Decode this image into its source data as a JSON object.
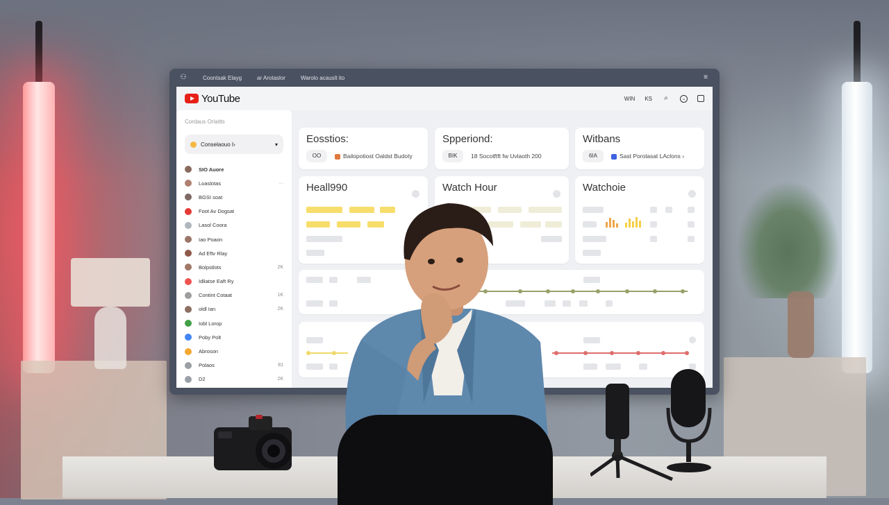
{
  "monitor": {
    "topbar": {
      "items": [
        "Coontsak Elayg",
        "ar Arotaslor",
        "Warolo acauslt ito"
      ]
    },
    "header": {
      "logo_text": "YouTube",
      "right_label": "WIN",
      "right_icon_1": "KS"
    },
    "sidebar": {
      "heading": "Cordaus Orlaitts",
      "select_label": "Conselaouo I›",
      "items": [
        {
          "label": "SIO Auore",
          "count": "",
          "color": "#8a6a5e",
          "bold": true
        },
        {
          "label": "Loaslotas",
          "count": "···",
          "color": "#b08070"
        },
        {
          "label": "BGSI soat",
          "count": "",
          "color": "#7d6a64"
        },
        {
          "label": "Foot Av Dogsat",
          "count": "",
          "color": "#e53935"
        },
        {
          "label": "Lasol Coora",
          "count": "",
          "color": "#b0b6bd"
        },
        {
          "label": "Iao Poaon",
          "count": "",
          "color": "#9b7668"
        },
        {
          "label": "Ad Eftv Rlay",
          "count": "",
          "color": "#8f5a48"
        },
        {
          "label": "Bolpstlots",
          "count": "2K",
          "color": "#a07868"
        },
        {
          "label": "Idliatse Eaft Ry",
          "count": "",
          "color": "#ef5350"
        },
        {
          "label": "Contint Cotaat",
          "count": "1K",
          "color": "#9e9e9e"
        },
        {
          "label": "oldl Ian",
          "count": "2K",
          "color": "#8d6e63"
        },
        {
          "label": "Iobl Lorop",
          "count": "",
          "color": "#43a047"
        },
        {
          "label": "Poby Polt",
          "count": "",
          "color": "#4285f4"
        },
        {
          "label": "Abroson",
          "count": "",
          "color": "#f4a832"
        },
        {
          "label": "Polaos",
          "count": "81",
          "color": "#9aa0a6"
        },
        {
          "label": "D2",
          "count": "2K",
          "color": "#9aa0a6"
        }
      ]
    },
    "stats": [
      {
        "title": "Eosstios:",
        "pill": "OO",
        "sub": "Bailopotiost Oaldst Budoty",
        "icon_color": "#e07a3f"
      },
      {
        "title": "Spperiond:",
        "pill": "BIK",
        "sub": "18 Socotftft fw Uvlaoth 200",
        "icon_color": ""
      },
      {
        "title": "Witbans",
        "pill": "6IA",
        "sub": "Sast Porolasat LAclons ›",
        "icon_color": "#3f62e0"
      }
    ],
    "panels": [
      {
        "title": "Heall990"
      },
      {
        "title": "Watch Hour"
      },
      {
        "title": "Watchoie"
      }
    ],
    "colors": {
      "accent_yellow": "#f7dd6b",
      "line_olive": "#9aa06a",
      "line_red": "#e06c6c",
      "youtube_red": "#e62117"
    }
  }
}
